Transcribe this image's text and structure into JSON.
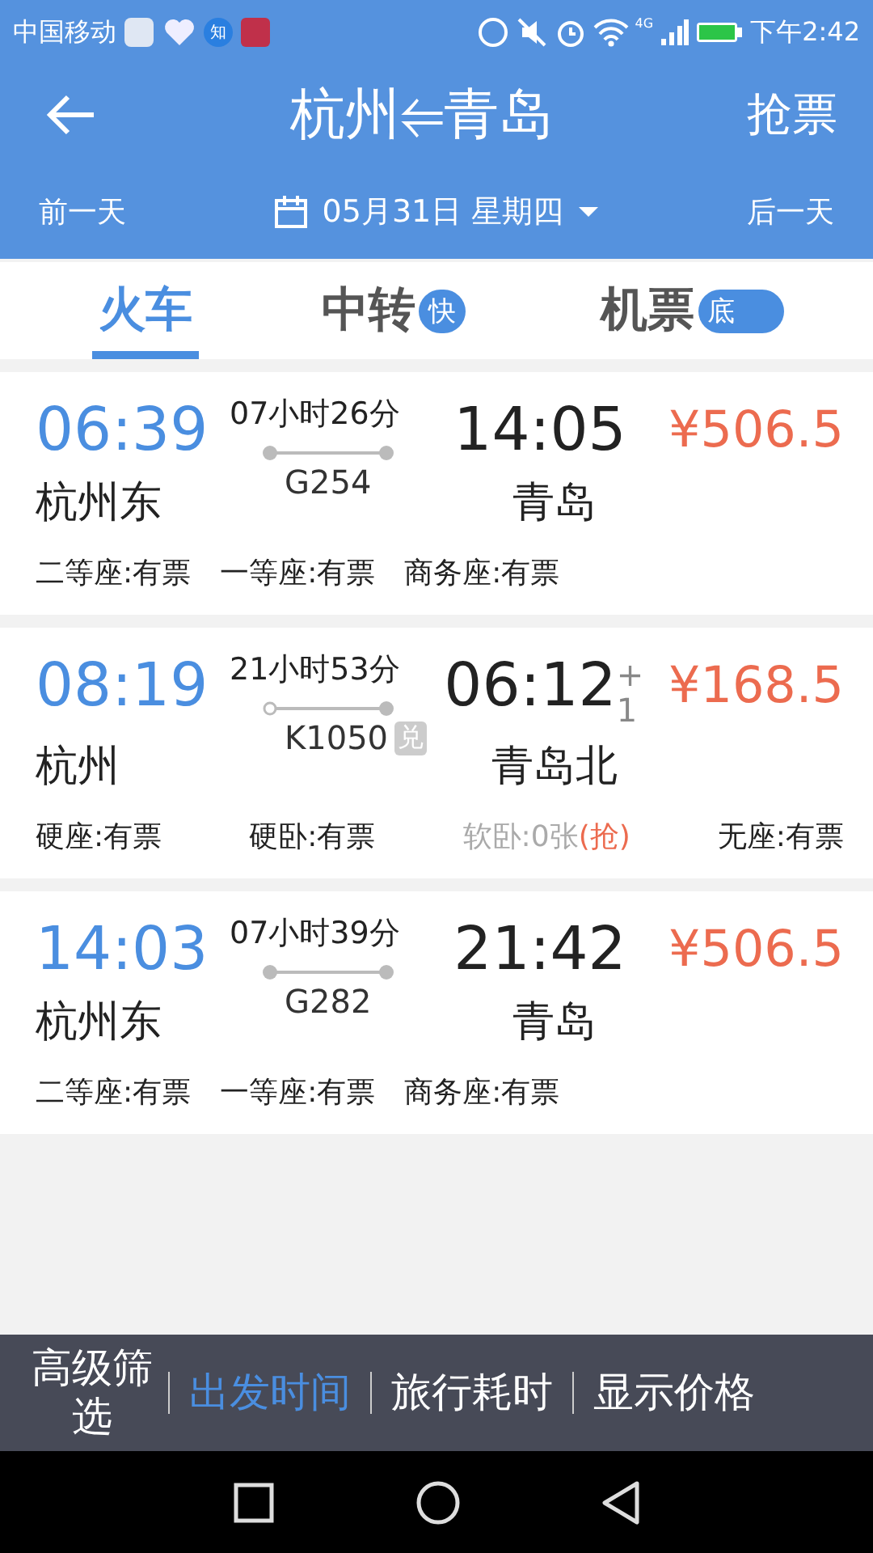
{
  "status_bar": {
    "carrier": "中国移动",
    "app_badge": "知",
    "network": "4G",
    "time": "下午2:42"
  },
  "header": {
    "title": "杭州⥢青岛",
    "action": "抢票",
    "prev_day": "前一天",
    "date": "05月31日 星期四",
    "next_day": "后一天"
  },
  "tabs": [
    {
      "label": "火车",
      "selected": true
    },
    {
      "label": "中转",
      "badge": "快",
      "selected": false
    },
    {
      "label": "机票",
      "badge": "底",
      "selected": false
    }
  ],
  "trains": [
    {
      "depart": "06:39",
      "duration": "07小时26分",
      "arrive": "14:05",
      "price": "¥506.5",
      "from": "杭州东",
      "number": "G254",
      "to": "青岛",
      "origin": true,
      "seats": [
        {
          "text": "二等座:有票",
          "kind": "available"
        },
        {
          "text": "一等座:有票",
          "kind": "available"
        },
        {
          "text": "商务座:有票",
          "kind": "available"
        }
      ]
    },
    {
      "depart": "08:19",
      "duration": "21小时53分",
      "arrive": "06:12",
      "day_offset": "+1",
      "price": "¥168.5",
      "from": "杭州",
      "number": "K1050",
      "number_badge": "兑",
      "to": "青岛北",
      "origin": false,
      "seats": [
        {
          "text": "硬座:有票",
          "kind": "available"
        },
        {
          "text": "硬卧:有票",
          "kind": "available"
        },
        {
          "text": "软卧:0张",
          "action": "(抢)",
          "kind": "soldout"
        },
        {
          "text": "无座:有票",
          "kind": "available"
        }
      ]
    },
    {
      "depart": "14:03",
      "duration": "07小时39分",
      "arrive": "21:42",
      "price": "¥506.5",
      "from": "杭州东",
      "number": "G282",
      "to": "青岛",
      "origin": true,
      "seats": [
        {
          "text": "二等座:有票",
          "kind": "available"
        },
        {
          "text": "一等座:有票",
          "kind": "available"
        },
        {
          "text": "商务座:有票",
          "kind": "available"
        }
      ]
    }
  ],
  "bottom_bar": [
    {
      "label": "高级筛选",
      "selected": false
    },
    {
      "label": "出发时间",
      "selected": true
    },
    {
      "label": "旅行耗时",
      "selected": false
    },
    {
      "label": "显示价格",
      "selected": false
    }
  ]
}
